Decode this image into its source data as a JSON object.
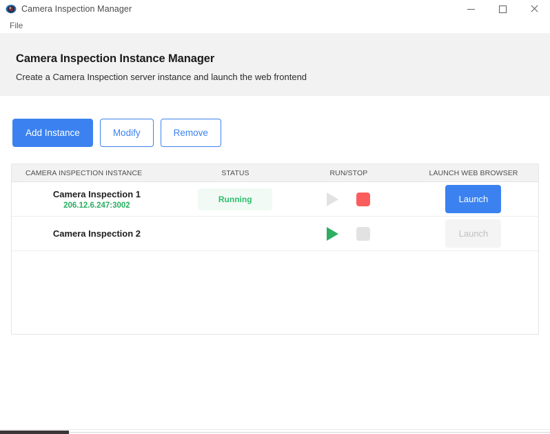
{
  "window": {
    "icon_name": "camera-eye-icon",
    "title": "Camera Inspection Manager",
    "minimize_label": "Minimize",
    "maximize_label": "Maximize",
    "close_label": "Close"
  },
  "menubar": {
    "items": [
      {
        "label": "File"
      }
    ]
  },
  "header": {
    "title": "Camera Inspection Instance Manager",
    "subtitle": "Create a Camera Inspection server instance and launch the web frontend"
  },
  "toolbar": {
    "add_label": "Add Instance",
    "modify_label": "Modify",
    "remove_label": "Remove"
  },
  "table": {
    "columns": [
      {
        "label": "CAMERA INSPECTION INSTANCE"
      },
      {
        "label": "STATUS"
      },
      {
        "label": "RUN/STOP"
      },
      {
        "label": "LAUNCH WEB BROWSER"
      }
    ],
    "rows": [
      {
        "name": "Camera Inspection 1",
        "address": "206.12.6.247:3002",
        "status": "Running",
        "run_enabled": false,
        "stop_enabled": true,
        "launch_label": "Launch",
        "launch_enabled": true
      },
      {
        "name": "Camera Inspection 2",
        "address": "",
        "status": "",
        "run_enabled": true,
        "stop_enabled": false,
        "launch_label": "Launch",
        "launch_enabled": false
      }
    ]
  },
  "colors": {
    "accent_blue": "#3b82f0",
    "status_green": "#2dbd6e",
    "address_green": "#27ae60",
    "stop_red": "#fb5d5d",
    "play_green": "#2dae63",
    "disabled_grey": "#e2e2e2",
    "header_band": "#f2f2f2"
  }
}
